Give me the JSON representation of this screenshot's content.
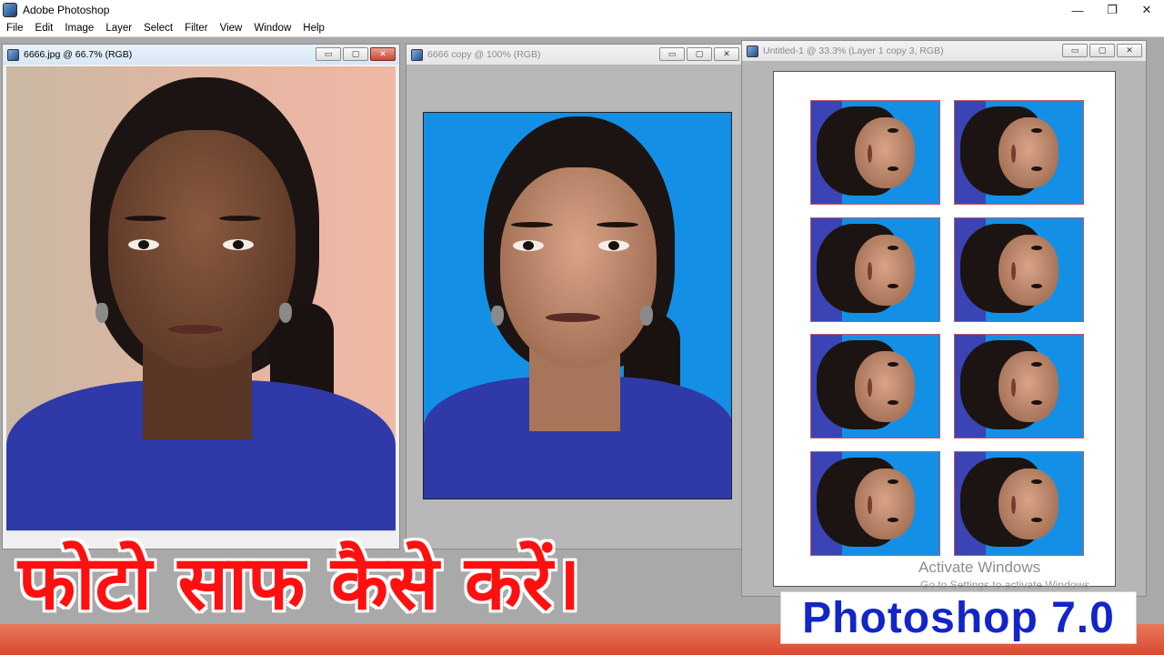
{
  "app": {
    "title": "Adobe Photoshop",
    "window_controls": [
      "—",
      "❐",
      "✕"
    ]
  },
  "menu": [
    "File",
    "Edit",
    "Image",
    "Layer",
    "Select",
    "Filter",
    "View",
    "Window",
    "Help"
  ],
  "documents": [
    {
      "title": "6666.jpg @ 66.7% (RGB)",
      "active": true,
      "buttons": [
        "▭",
        "▢",
        "✕"
      ]
    },
    {
      "title": "6666 copy @ 100% (RGB)",
      "active": false,
      "buttons": [
        "▭",
        "▢",
        "✕"
      ]
    },
    {
      "title": "Untitled-1 @ 33.3% (Layer 1 copy 3, RGB)",
      "active": false,
      "buttons": [
        "▭",
        "▢",
        "✕"
      ]
    }
  ],
  "passport_sheet": {
    "rows": 4,
    "columns": 2,
    "background_color": "#1390e6",
    "border_color": "#c0566a"
  },
  "watermark": {
    "line1": "Activate Windows",
    "line2": "Go to Settings to activate Windows."
  },
  "overlay": {
    "headline": "फोटो साफ कैसे करें।",
    "headline_color": "#ff1010",
    "badge": "Photoshop 7.0",
    "badge_color": "#1225c9"
  },
  "colors": {
    "workspace": "#a9a9a9",
    "taskbar": "#d94a30"
  }
}
